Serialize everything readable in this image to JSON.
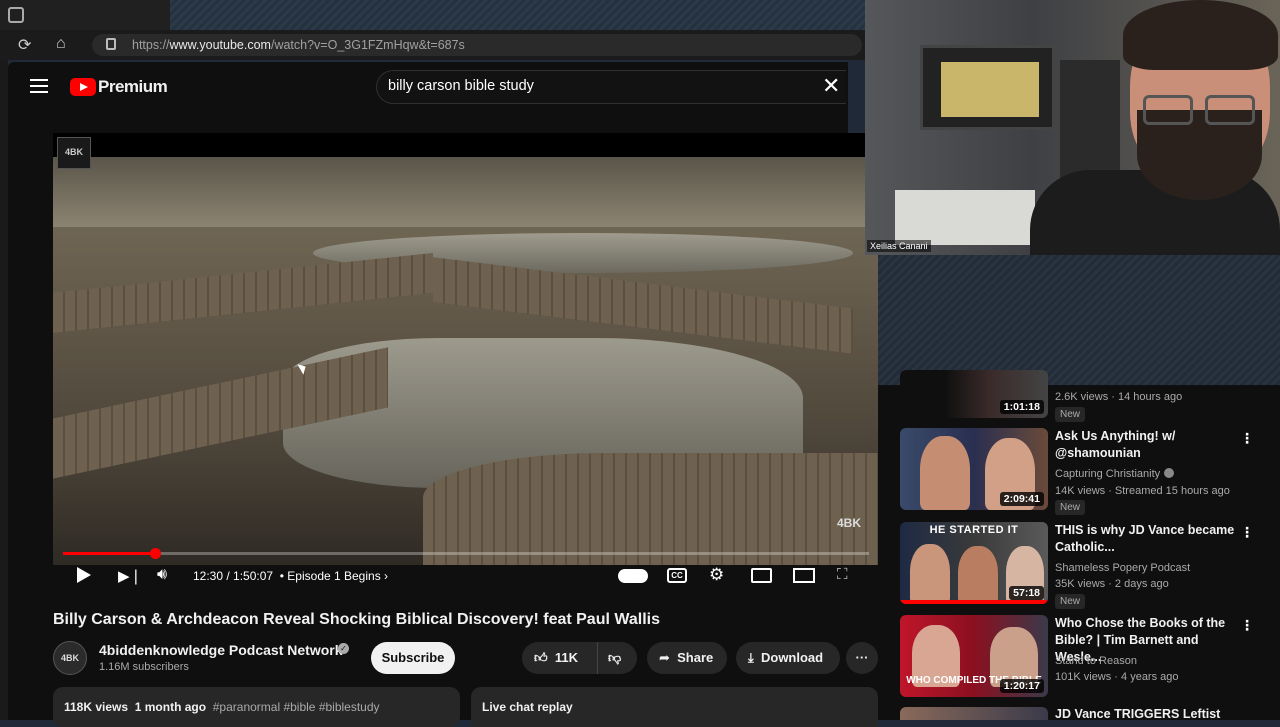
{
  "browser": {
    "url_prefix": "https://",
    "url_host": "www.youtube.com",
    "url_path": "/watch?v=O_3G1FZmHqw&t=687s"
  },
  "header": {
    "logo_text": "Premium",
    "search_value": "billy carson bible study"
  },
  "player": {
    "current_time": "12:30",
    "duration": "1:50:07",
    "chapter": "Episode 1 Begins",
    "progress": 0.114,
    "watermark": "4BK",
    "channel_badge": "4BK"
  },
  "video": {
    "title": "Billy Carson & Archdeacon Reveal Shocking Biblical Discovery! feat Paul Wallis",
    "channel": "4biddenknowledge Podcast Network",
    "subscribers": "1.16M subscribers",
    "subscribe_label": "Subscribe",
    "likes": "11K",
    "share_label": "Share",
    "download_label": "Download",
    "views": "118K views",
    "age": "1 month ago",
    "tags": "#paranormal #bible #biblestudy",
    "live_chat_label": "Live chat replay"
  },
  "webcam": {
    "name": "Xeilias Canani"
  },
  "sidebar": {
    "items": [
      {
        "duration": "1:01:18",
        "title": "",
        "channel": "",
        "meta": "2.6K views · 14 hours ago",
        "badge": "New"
      },
      {
        "duration": "2:09:41",
        "title": "Ask Us Anything! w/ @shamounian",
        "channel": "Capturing Christianity",
        "meta": "14K views · Streamed 15 hours ago",
        "badge": "New"
      },
      {
        "duration": "57:18",
        "title": "THIS is why JD Vance became Catholic...",
        "channel": "Shameless Popery Podcast",
        "meta": "35K views · 2 days ago",
        "badge": "New",
        "thumb_text": "HE STARTED IT"
      },
      {
        "duration": "1:20:17",
        "title": "Who Chose the Books of the Bible? | Tim Barnett and Wesle...",
        "channel": "Stand to Reason",
        "meta": "101K views · 4 years ago",
        "badge": "",
        "thumb_text": "WHO COMPILED THE BIBLE"
      },
      {
        "duration": "",
        "title": "JD Vance TRIGGERS Leftist",
        "channel": "",
        "meta": "",
        "badge": ""
      }
    ]
  }
}
